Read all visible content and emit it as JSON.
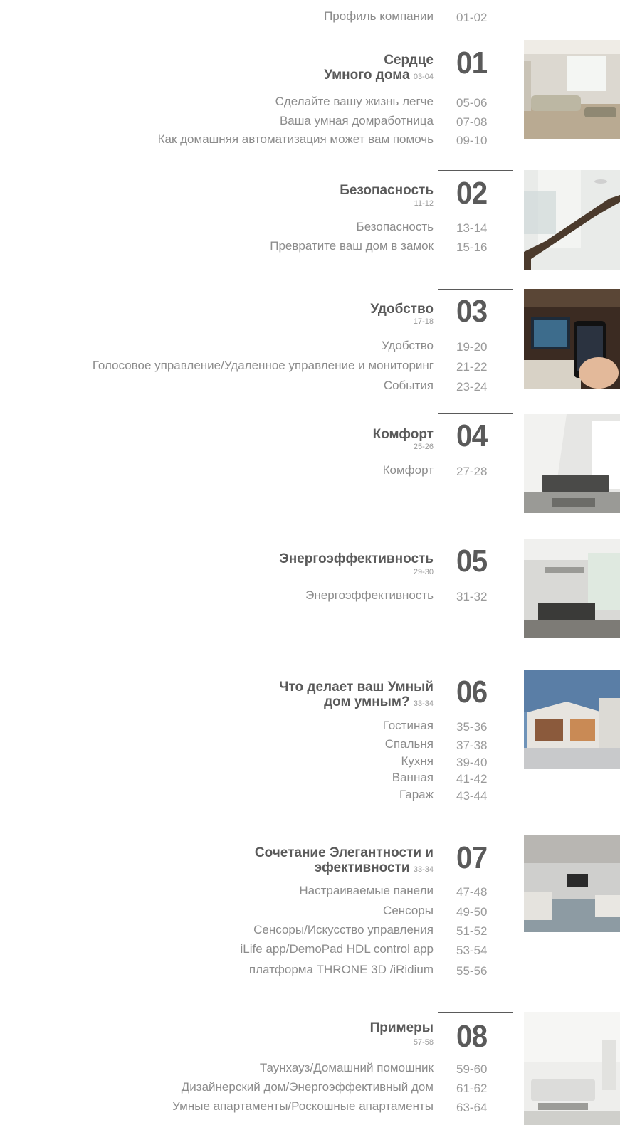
{
  "profile": {
    "label": "Профиль компании",
    "pages": "01-02"
  },
  "sections": [
    {
      "number": "01",
      "title_lines": [
        "Сердце",
        "Умного дома"
      ],
      "title_pages": "03-04",
      "items": [
        {
          "label": "Сделайте вашу жизнь легче",
          "pages": "05-06"
        },
        {
          "label": "Ваша умная домработница",
          "pages": "07-08"
        },
        {
          "label": "Как домашняя автоматизация может вам помочь",
          "pages": "09-10"
        }
      ]
    },
    {
      "number": "02",
      "title_lines": [
        "Безопасность"
      ],
      "title_pages": "11-12",
      "items": [
        {
          "label": "Безопасность",
          "pages": "13-14"
        },
        {
          "label": "Превратите ваш дом в замок",
          "pages": "15-16"
        }
      ]
    },
    {
      "number": "03",
      "title_lines": [
        "Удобство"
      ],
      "title_pages": "17-18",
      "items": [
        {
          "label": "Удобство",
          "pages": "19-20"
        },
        {
          "label": "Голосовое управление/Удаленное управление и мониторинг",
          "pages": "21-22"
        },
        {
          "label": "События",
          "pages": "23-24"
        }
      ]
    },
    {
      "number": "04",
      "title_lines": [
        "Комфорт"
      ],
      "title_pages": "25-26",
      "items": [
        {
          "label": "Комфорт",
          "pages": "27-28"
        }
      ]
    },
    {
      "number": "05",
      "title_lines": [
        "Энергоэффективность"
      ],
      "title_pages": "29-30",
      "items": [
        {
          "label": "Энергоэффективность",
          "pages": "31-32"
        }
      ]
    },
    {
      "number": "06",
      "title_lines": [
        "Что делает ваш Умный",
        "дом умным?"
      ],
      "title_pages": "33-34",
      "items": [
        {
          "label": "Гостиная",
          "pages": "35-36"
        },
        {
          "label": "Спальня",
          "pages": "37-38"
        },
        {
          "label": "Кухня",
          "pages": "39-40"
        },
        {
          "label": "Ванная",
          "pages": "41-42"
        },
        {
          "label": "Гараж",
          "pages": "43-44"
        }
      ]
    },
    {
      "number": "07",
      "title_lines": [
        "Сочетание Элегантности и",
        "эфективности"
      ],
      "title_pages": "33-34",
      "items": [
        {
          "label": "Настраиваемые панели",
          "pages": "47-48"
        },
        {
          "label": "Сенсоры",
          "pages": "49-50"
        },
        {
          "label": "Сенсоры/Искусство управления",
          "pages": "51-52"
        },
        {
          "label": "iLife app/DemoPad HDL control app",
          "pages": "53-54"
        },
        {
          "label": "платформа THRONE 3D /iRidium",
          "pages": "55-56"
        }
      ]
    },
    {
      "number": "08",
      "title_lines": [
        "Примеры"
      ],
      "title_pages": "57-58",
      "items": [
        {
          "label": "Таунхауз/Домашний помошник",
          "pages": "59-60"
        },
        {
          "label": "Дизайнерский дом/Энергоэффективный дом",
          "pages": "61-62"
        },
        {
          "label": "Умные апартаменты/Роскошные апартаменты",
          "pages": "63-64"
        }
      ]
    }
  ]
}
